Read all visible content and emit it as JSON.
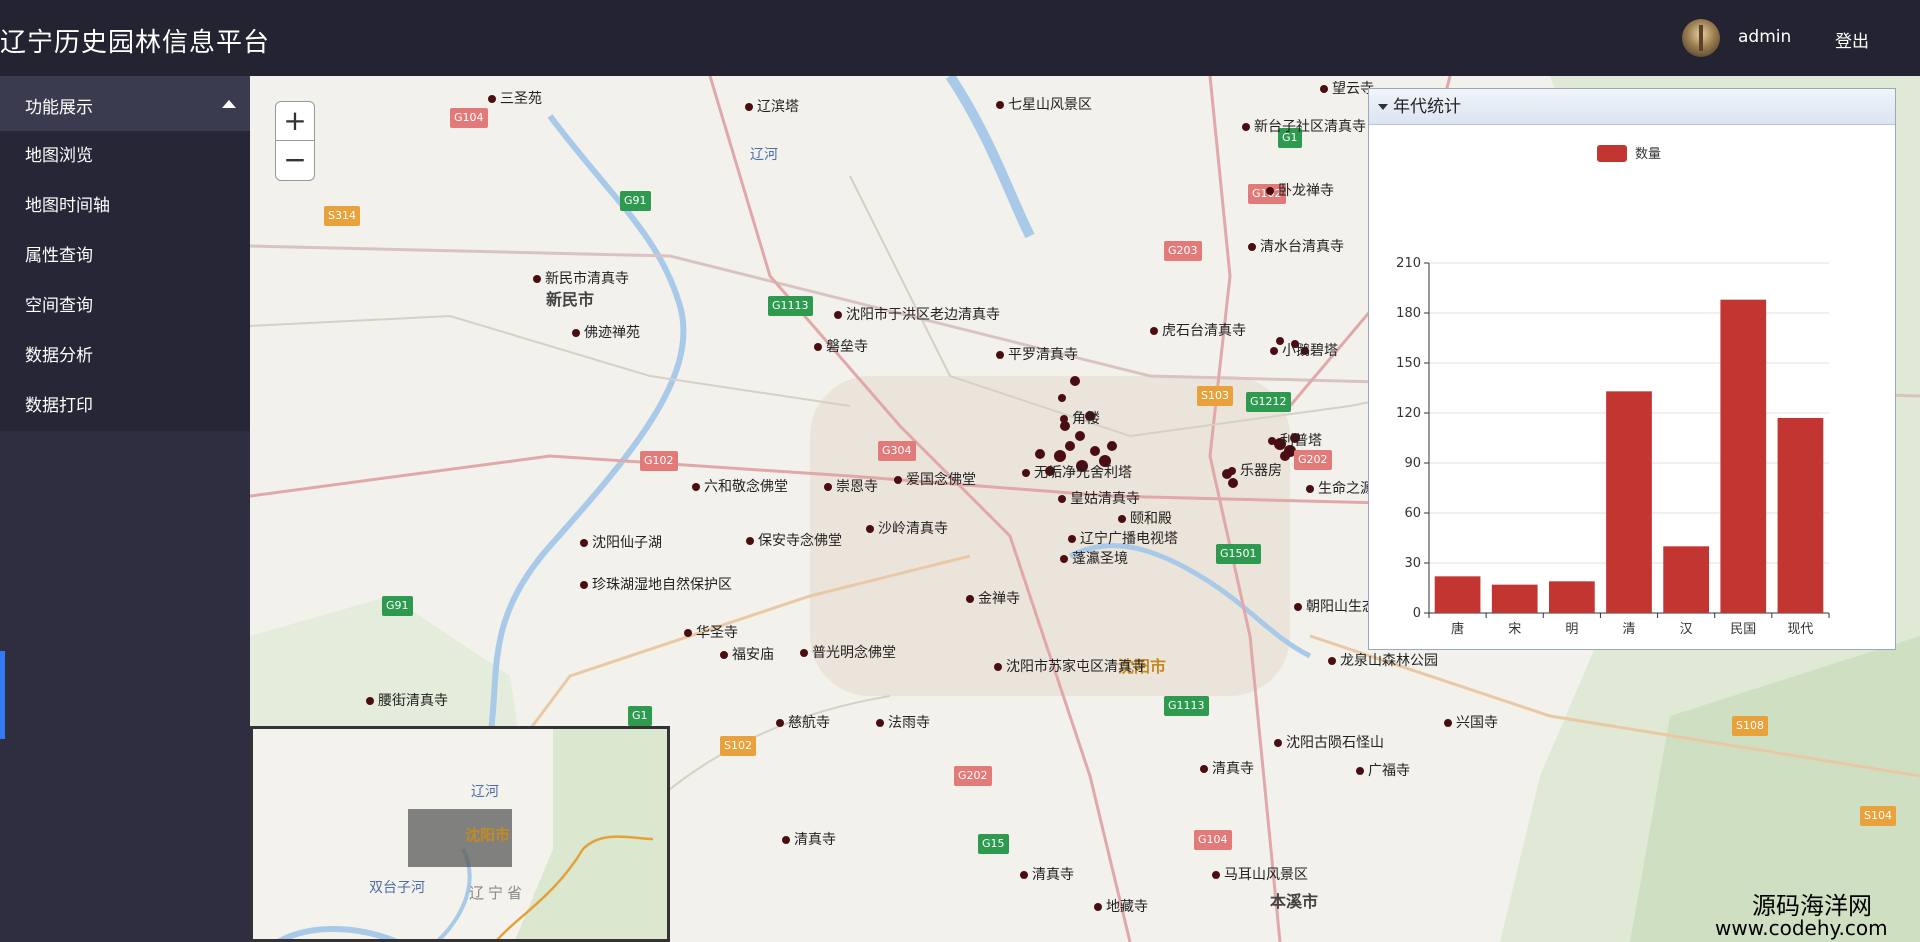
{
  "header": {
    "title": "辽宁历史园林信息平台",
    "username": "admin",
    "logout_label": "登出"
  },
  "sidebar": {
    "group_label": "功能展示",
    "items": [
      {
        "label": "地图浏览"
      },
      {
        "label": "地图时间轴"
      },
      {
        "label": "属性查询"
      },
      {
        "label": "空间查询"
      },
      {
        "label": "数据分析"
      },
      {
        "label": "数据打印"
      }
    ]
  },
  "map": {
    "zoom_in": "+",
    "zoom_out": "−",
    "pois": [
      {
        "name": "三圣苑"
      },
      {
        "name": "辽滨塔"
      },
      {
        "name": "七星山风景区"
      },
      {
        "name": "望云寺"
      },
      {
        "name": "新台子社区清真寺"
      },
      {
        "name": "卧龙禅寺"
      },
      {
        "name": "清水台清真寺"
      },
      {
        "name": "新民市清真寺"
      },
      {
        "name": "沈阳市于洪区老边清真寺"
      },
      {
        "name": "佛迹禅苑"
      },
      {
        "name": "磐垒寺"
      },
      {
        "name": "平罗清真寺"
      },
      {
        "name": "虎石台清真寺"
      },
      {
        "name": "小鹅碧塔"
      },
      {
        "name": "角楼"
      },
      {
        "name": "无垢净光舍利塔"
      },
      {
        "name": "利普塔"
      },
      {
        "name": "六和敬念佛堂"
      },
      {
        "name": "崇恩寺"
      },
      {
        "name": "爱国念佛堂"
      },
      {
        "name": "皇姑清真寺"
      },
      {
        "name": "颐和殿"
      },
      {
        "name": "保安寺念佛堂"
      },
      {
        "name": "沙岭清真寺"
      },
      {
        "name": "辽宁广播电视塔"
      },
      {
        "name": "蓬瀛圣境"
      },
      {
        "name": "沈阳仙子湖"
      },
      {
        "name": "珍珠湖湿地自然保护区"
      },
      {
        "name": "金禅寺"
      },
      {
        "name": "朝阳山生态园"
      },
      {
        "name": "生命之源"
      },
      {
        "name": "华圣寺"
      },
      {
        "name": "福安庙"
      },
      {
        "name": "普光明念佛堂"
      },
      {
        "name": "沈阳市苏家屯区清真寺"
      },
      {
        "name": "龙泉山森林公园"
      },
      {
        "name": "腰街清真寺"
      },
      {
        "name": "慈航寺"
      },
      {
        "name": "法雨寺"
      },
      {
        "name": "沈阳古陨石怪山"
      },
      {
        "name": "兴国寺"
      },
      {
        "name": "清真寺"
      },
      {
        "name": "广福寺"
      },
      {
        "name": "清真寺"
      },
      {
        "name": "清真寺"
      },
      {
        "name": "马耳山风景区"
      },
      {
        "name": "地藏寺"
      },
      {
        "name": "乐器房"
      }
    ],
    "places": [
      {
        "name": "辽河"
      },
      {
        "name": "新民市"
      },
      {
        "name": "沈阳市"
      },
      {
        "name": "本溪市"
      }
    ],
    "shields": [
      {
        "code": "G104"
      },
      {
        "code": "S314"
      },
      {
        "code": "G91"
      },
      {
        "code": "G1113"
      },
      {
        "code": "G102"
      },
      {
        "code": "G304"
      },
      {
        "code": "G203"
      },
      {
        "code": "G1"
      },
      {
        "code": "G102"
      },
      {
        "code": "S103"
      },
      {
        "code": "G1212"
      },
      {
        "code": "G202"
      },
      {
        "code": "G1501"
      },
      {
        "code": "G91"
      },
      {
        "code": "G1"
      },
      {
        "code": "S102"
      },
      {
        "code": "G202"
      },
      {
        "code": "G1113"
      },
      {
        "code": "G15"
      },
      {
        "code": "G104"
      },
      {
        "code": "S108"
      },
      {
        "code": "S104"
      }
    ],
    "overview": {
      "river": "辽河",
      "city": "沈阳市",
      "river2": "双台子河",
      "province": "辽宁省"
    }
  },
  "panel": {
    "title": "年代统计",
    "chart_data": {
      "type": "bar",
      "categories": [
        "唐",
        "宋",
        "明",
        "清",
        "汉",
        "民国",
        "现代"
      ],
      "series": [
        {
          "name": "数量",
          "values": [
            22,
            17,
            19,
            133,
            40,
            188,
            117
          ],
          "color": "#c23531"
        }
      ],
      "ylim": [
        0,
        210
      ],
      "yticks": [
        0,
        30,
        60,
        90,
        120,
        150,
        180,
        210
      ],
      "grid": true,
      "legend": "top-center"
    }
  },
  "watermark": {
    "line1": "源码海洋网",
    "line2": "www.codehy.com"
  }
}
